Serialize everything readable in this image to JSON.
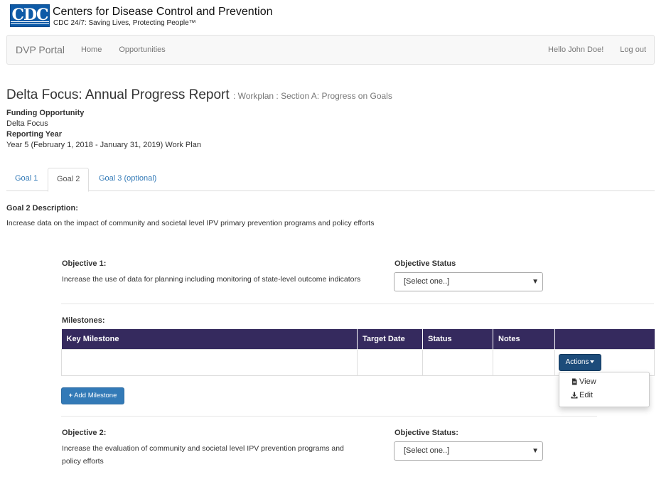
{
  "header": {
    "logo_text": "CDC",
    "title": "Centers for Disease Control and Prevention",
    "tagline": "CDC 24/7: Saving Lives, Protecting People™"
  },
  "navbar": {
    "brand": "DVP Portal",
    "links": [
      "Home",
      "Opportunities"
    ],
    "greeting": "Hello John Doe!",
    "logout": "Log out"
  },
  "page": {
    "title": "Delta Focus: Annual Progress Report",
    "subtitle": ": Workplan : Section A: Progress on Goals"
  },
  "meta": {
    "funding_label": "Funding Opportunity",
    "funding_value": "Delta Focus",
    "year_label": "Reporting Year",
    "year_value": "Year 5 (February 1, 2018 - January 31, 2019) Work Plan"
  },
  "tabs": [
    {
      "label": "Goal 1",
      "active": false
    },
    {
      "label": "Goal 2",
      "active": true
    },
    {
      "label": "Goal 3 (optional)",
      "active": false
    }
  ],
  "goal": {
    "desc_label": "Goal 2 Description:",
    "desc_text": "Increase data on the impact of community and societal level IPV primary prevention programs and policy efforts"
  },
  "objectives": [
    {
      "label": "Objective 1:",
      "text": "Increase the use of data for planning including monitoring of state-level outcome indicators",
      "status_label": "Objective Status",
      "status_value": "[Select one..]"
    },
    {
      "label": "Objective 2:",
      "text_line1": "Increase the evaluation of community and societal level IPV prevention programs and",
      "text_line2": "policy efforts",
      "status_label": "Objective Status:",
      "status_value": "[Select one..]"
    }
  ],
  "milestones": {
    "label": "Milestones:",
    "columns": [
      "Key Milestone",
      "Target Date",
      "Status",
      "Notes",
      ""
    ],
    "actions_label": "Actions",
    "menu": [
      "View",
      "Edit"
    ],
    "add_label": "Add Milestone"
  },
  "colors": {
    "table_header": "#352a5e",
    "actions_button": "#1d4c7a",
    "primary_button": "#337ab7",
    "link": "#337ab7"
  },
  "icons": [
    "file-icon",
    "download-icon",
    "plus-icon",
    "caret-down-icon",
    "select-arrow-icon"
  ]
}
